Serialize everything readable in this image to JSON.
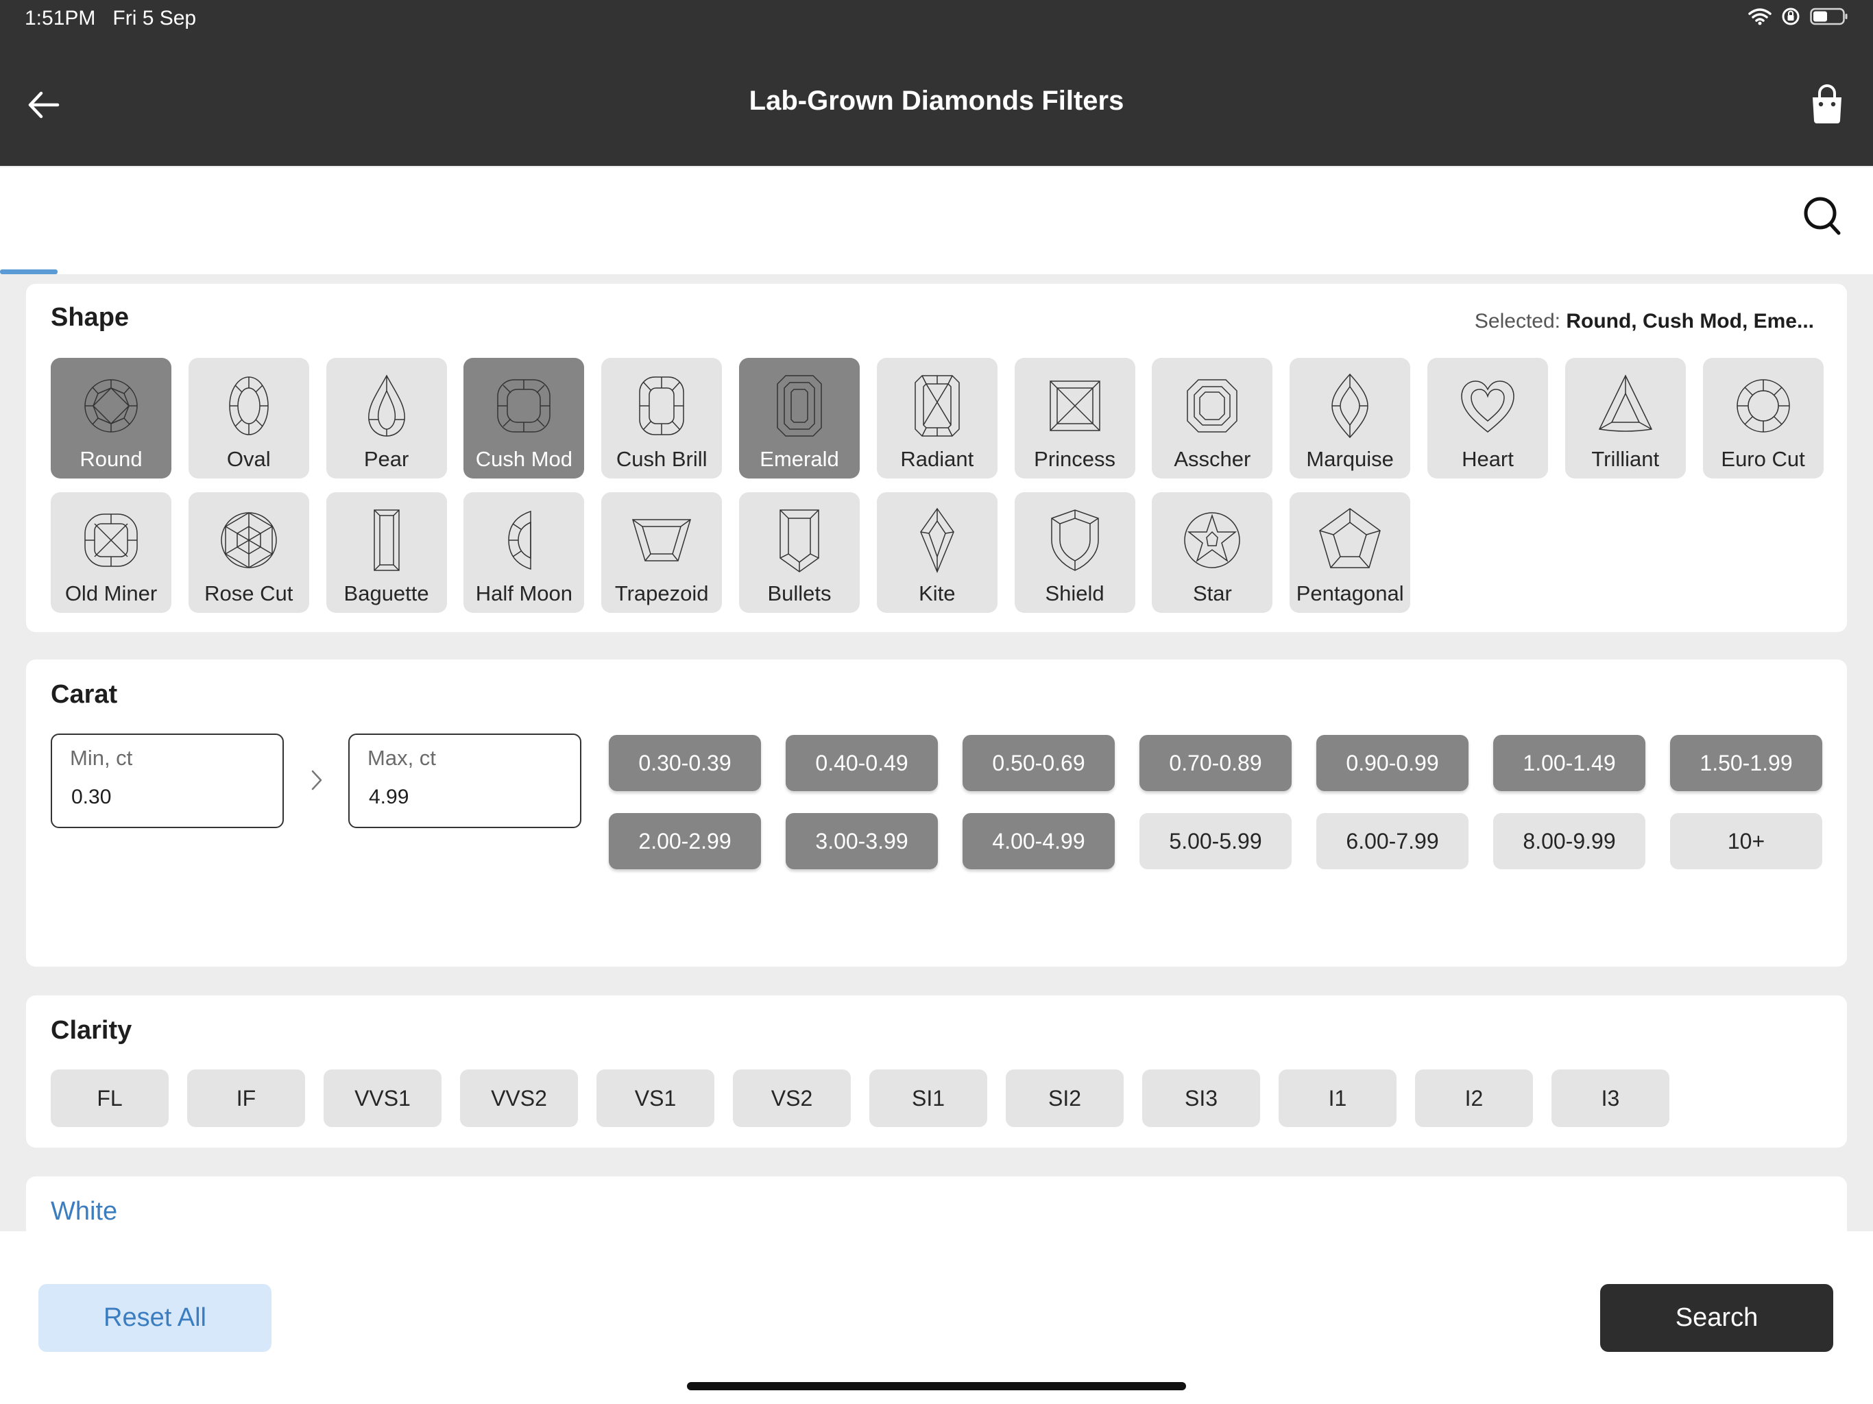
{
  "status_bar": {
    "time": "1:51PM",
    "date": "Fri 5 Sep",
    "icons": [
      "wifi-icon",
      "orientation-lock-icon",
      "battery-icon"
    ]
  },
  "header": {
    "title": "Lab-Grown Diamonds Filters",
    "back_icon": "arrow-left-icon",
    "cart_icon": "shopping-bag-icon"
  },
  "search": {
    "icon": "search-icon"
  },
  "shape": {
    "title": "Shape",
    "selected_prefix": "Selected:",
    "selected_value": "Round, Cush Mod, Eme...",
    "items": [
      {
        "label": "Round",
        "icon": "round-shape-icon",
        "selected": true
      },
      {
        "label": "Oval",
        "icon": "oval-shape-icon",
        "selected": false
      },
      {
        "label": "Pear",
        "icon": "pear-shape-icon",
        "selected": false
      },
      {
        "label": "Cush Mod",
        "icon": "cushion-modified-shape-icon",
        "selected": true
      },
      {
        "label": "Cush Brill",
        "icon": "cushion-brilliant-shape-icon",
        "selected": false
      },
      {
        "label": "Emerald",
        "icon": "emerald-shape-icon",
        "selected": true
      },
      {
        "label": "Radiant",
        "icon": "radiant-shape-icon",
        "selected": false
      },
      {
        "label": "Princess",
        "icon": "princess-shape-icon",
        "selected": false
      },
      {
        "label": "Asscher",
        "icon": "asscher-shape-icon",
        "selected": false
      },
      {
        "label": "Marquise",
        "icon": "marquise-shape-icon",
        "selected": false
      },
      {
        "label": "Heart",
        "icon": "heart-shape-icon",
        "selected": false
      },
      {
        "label": "Trilliant",
        "icon": "trilliant-shape-icon",
        "selected": false
      },
      {
        "label": "Euro Cut",
        "icon": "euro-cut-shape-icon",
        "selected": false
      },
      {
        "label": "Old Miner",
        "icon": "old-miner-shape-icon",
        "selected": false
      },
      {
        "label": "Rose Cut",
        "icon": "rose-cut-shape-icon",
        "selected": false
      },
      {
        "label": "Baguette",
        "icon": "baguette-shape-icon",
        "selected": false
      },
      {
        "label": "Half Moon",
        "icon": "half-moon-shape-icon",
        "selected": false
      },
      {
        "label": "Trapezoid",
        "icon": "trapezoid-shape-icon",
        "selected": false
      },
      {
        "label": "Bullets",
        "icon": "bullets-shape-icon",
        "selected": false
      },
      {
        "label": "Kite",
        "icon": "kite-shape-icon",
        "selected": false
      },
      {
        "label": "Shield",
        "icon": "shield-shape-icon",
        "selected": false
      },
      {
        "label": "Star",
        "icon": "star-shape-icon",
        "selected": false
      },
      {
        "label": "Pentagonal",
        "icon": "pentagonal-shape-icon",
        "selected": false
      }
    ]
  },
  "carat": {
    "title": "Carat",
    "min": {
      "placeholder": "Min, ct",
      "value": "0.30"
    },
    "max": {
      "placeholder": "Max, ct",
      "value": "4.99"
    },
    "ranges": [
      {
        "label": "0.30-0.39",
        "selected": true
      },
      {
        "label": "0.40-0.49",
        "selected": true
      },
      {
        "label": "0.50-0.69",
        "selected": true
      },
      {
        "label": "0.70-0.89",
        "selected": true
      },
      {
        "label": "0.90-0.99",
        "selected": true
      },
      {
        "label": "1.00-1.49",
        "selected": true
      },
      {
        "label": "1.50-1.99",
        "selected": true
      },
      {
        "label": "2.00-2.99",
        "selected": true
      },
      {
        "label": "3.00-3.99",
        "selected": true
      },
      {
        "label": "4.00-4.99",
        "selected": true
      },
      {
        "label": "5.00-5.99",
        "selected": false
      },
      {
        "label": "6.00-7.99",
        "selected": false
      },
      {
        "label": "8.00-9.99",
        "selected": false
      },
      {
        "label": "10+",
        "selected": false
      }
    ]
  },
  "clarity": {
    "title": "Clarity",
    "items": [
      "FL",
      "IF",
      "VVS1",
      "VVS2",
      "VS1",
      "VS2",
      "SI1",
      "SI2",
      "SI3",
      "I1",
      "I2",
      "I3"
    ]
  },
  "color_section": {
    "title": "White"
  },
  "footer": {
    "reset_label": "Reset All",
    "search_label": "Search"
  },
  "colors": {
    "header_bg": "#333333",
    "selected_bg": "#858585",
    "tile_bg": "#e4e4e4",
    "accent_blue": "#3b7dbf",
    "reset_bg": "#d7e8fb"
  }
}
